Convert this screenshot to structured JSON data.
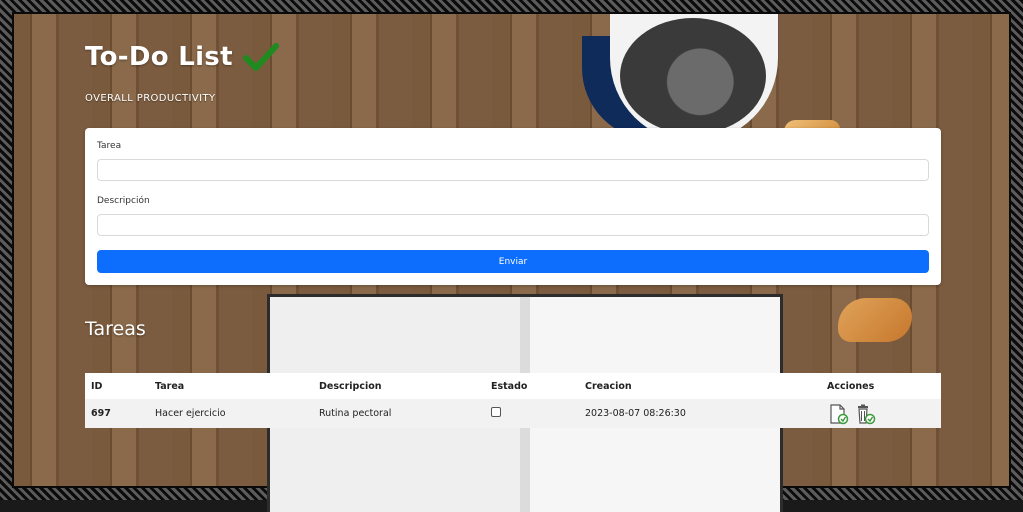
{
  "header": {
    "title": "To-Do List",
    "subtitle": "OVERALL PRODUCTIVITY",
    "check_icon": "checkmark-icon",
    "check_color": "#1f8a1f"
  },
  "form": {
    "task_label": "Tarea",
    "task_value": "",
    "description_label": "Descripción",
    "description_value": "",
    "submit_label": "Enviar",
    "submit_color": "#0d6efd"
  },
  "tasks_section": {
    "title": "Tareas",
    "columns": [
      "ID",
      "Tarea",
      "Descripcion",
      "Estado",
      "Creacion",
      "Acciones"
    ],
    "rows": [
      {
        "id": "697",
        "task": "Hacer ejercicio",
        "description": "Rutina pectoral",
        "status_checked": false,
        "created": "2023-08-07 08:26:30",
        "actions": [
          "edit-document-icon",
          "delete-trash-icon"
        ]
      }
    ]
  }
}
